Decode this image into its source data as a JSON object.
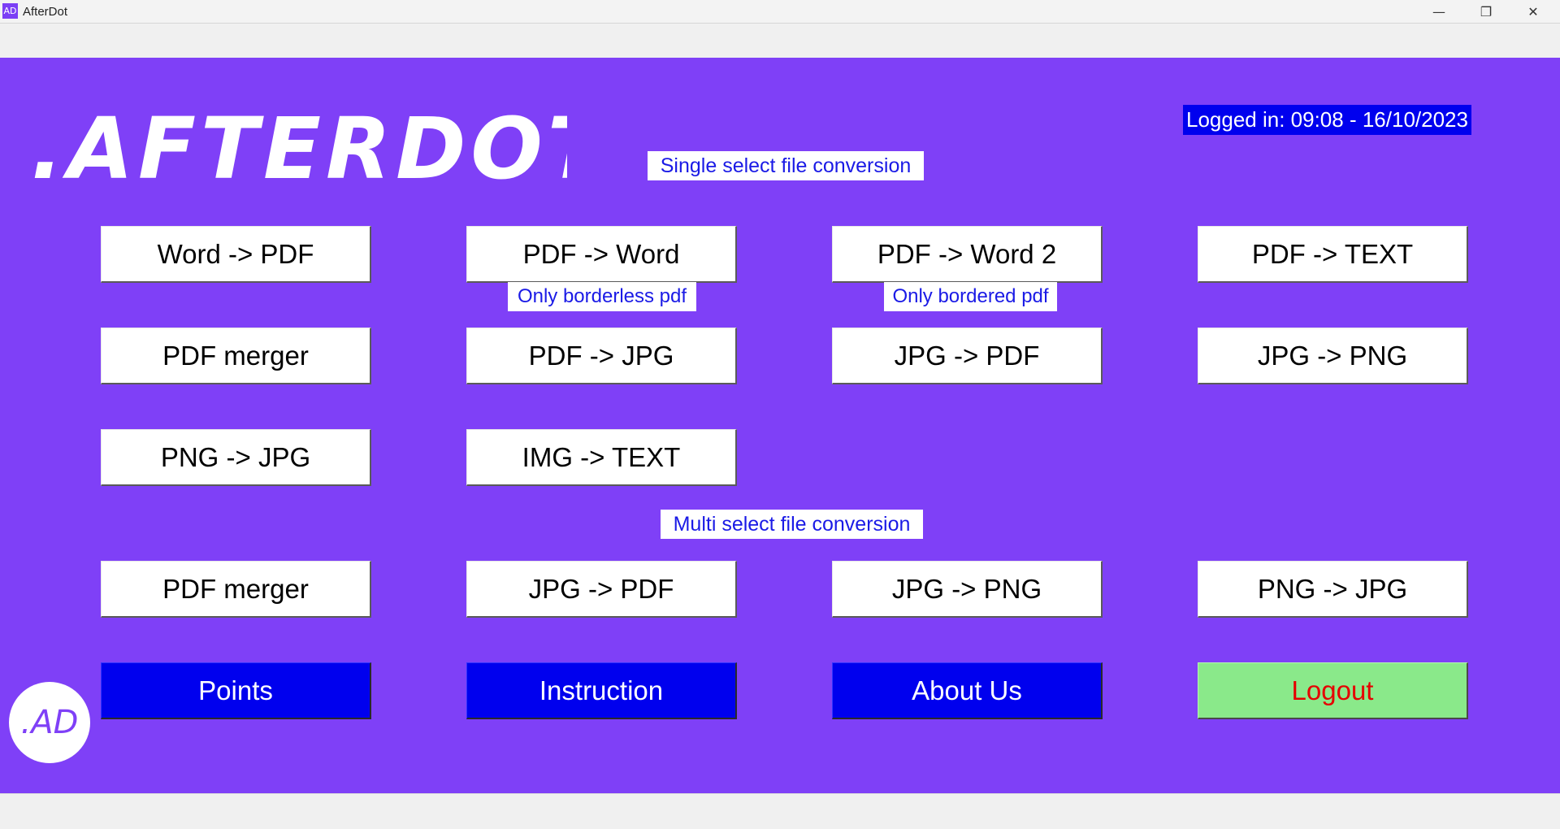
{
  "window": {
    "app_icon_text": "AD",
    "title": "AfterDot",
    "minimize_glyph": "—",
    "maximize_glyph": "❐",
    "close_glyph": "✕"
  },
  "header": {
    "logo_text": ".AFTERDOT",
    "logged_in": "Logged in: 09:08 - 16/10/2023"
  },
  "single": {
    "heading": "Single select file conversion",
    "notes": {
      "pdf_to_word": "Only borderless pdf",
      "pdf_to_word_2": "Only bordered pdf"
    },
    "buttons": {
      "word_to_pdf": "Word -> PDF",
      "pdf_to_word": "PDF -> Word",
      "pdf_to_word_2": "PDF -> Word 2",
      "pdf_to_text": "PDF -> TEXT",
      "pdf_merger": "PDF merger",
      "pdf_to_jpg": "PDF -> JPG",
      "jpg_to_pdf": "JPG -> PDF",
      "jpg_to_png": "JPG -> PNG",
      "png_to_jpg": "PNG -> JPG",
      "img_to_text": "IMG -> TEXT"
    }
  },
  "multi": {
    "heading": "Multi select file conversion",
    "buttons": {
      "pdf_merger": "PDF merger",
      "jpg_to_pdf": "JPG -> PDF",
      "jpg_to_png": "JPG -> PNG",
      "png_to_jpg": "PNG -> JPG"
    }
  },
  "nav": {
    "points": "Points",
    "instruction": "Instruction",
    "about_us": "About Us",
    "logout": "Logout"
  },
  "badge": {
    "text": ".AD"
  },
  "colors": {
    "canvas": "#7f40f7",
    "nav_button": "#0000ee",
    "logout_button": "#8ae98a",
    "logout_text": "#e60000",
    "label_text": "#1a1ae6"
  }
}
